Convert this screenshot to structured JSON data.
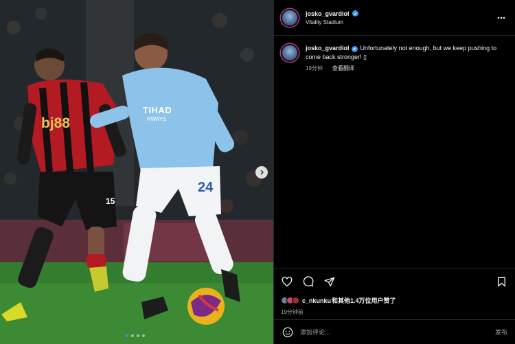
{
  "post": {
    "username": "josko_gvardiol",
    "location": "Vitality Stadium",
    "more_icon": "more-horizontal-icon"
  },
  "photo": {
    "sponsor_text": "bj88",
    "shirt_text": "TIHAD",
    "shirt_subtext": "RWAYS",
    "shorts_number": "24",
    "away_number": "15",
    "carousel_index": 1,
    "carousel_count": 4
  },
  "caption": {
    "username": "josko_gvardiol",
    "text": "Unfortunately not enough, but we keep pushing to come back stronger! ▯",
    "time": "19分钟",
    "translate_label": "查看翻译"
  },
  "actions": {
    "like_icon": "heart-icon",
    "comment_icon": "comment-icon",
    "share_icon": "send-icon",
    "save_icon": "bookmark-icon"
  },
  "likes": {
    "user": "c_nkunku",
    "rest": "和其他1.4万位用户赞了"
  },
  "timestamp": "19分钟前",
  "comment": {
    "placeholder": "添加评论...",
    "post_label": "发布",
    "emoji_icon": "emoji-icon"
  },
  "colors": {
    "accent": "#3897f0",
    "city_blue": "#8dc3ea",
    "bournemouth_red": "#d71920"
  }
}
